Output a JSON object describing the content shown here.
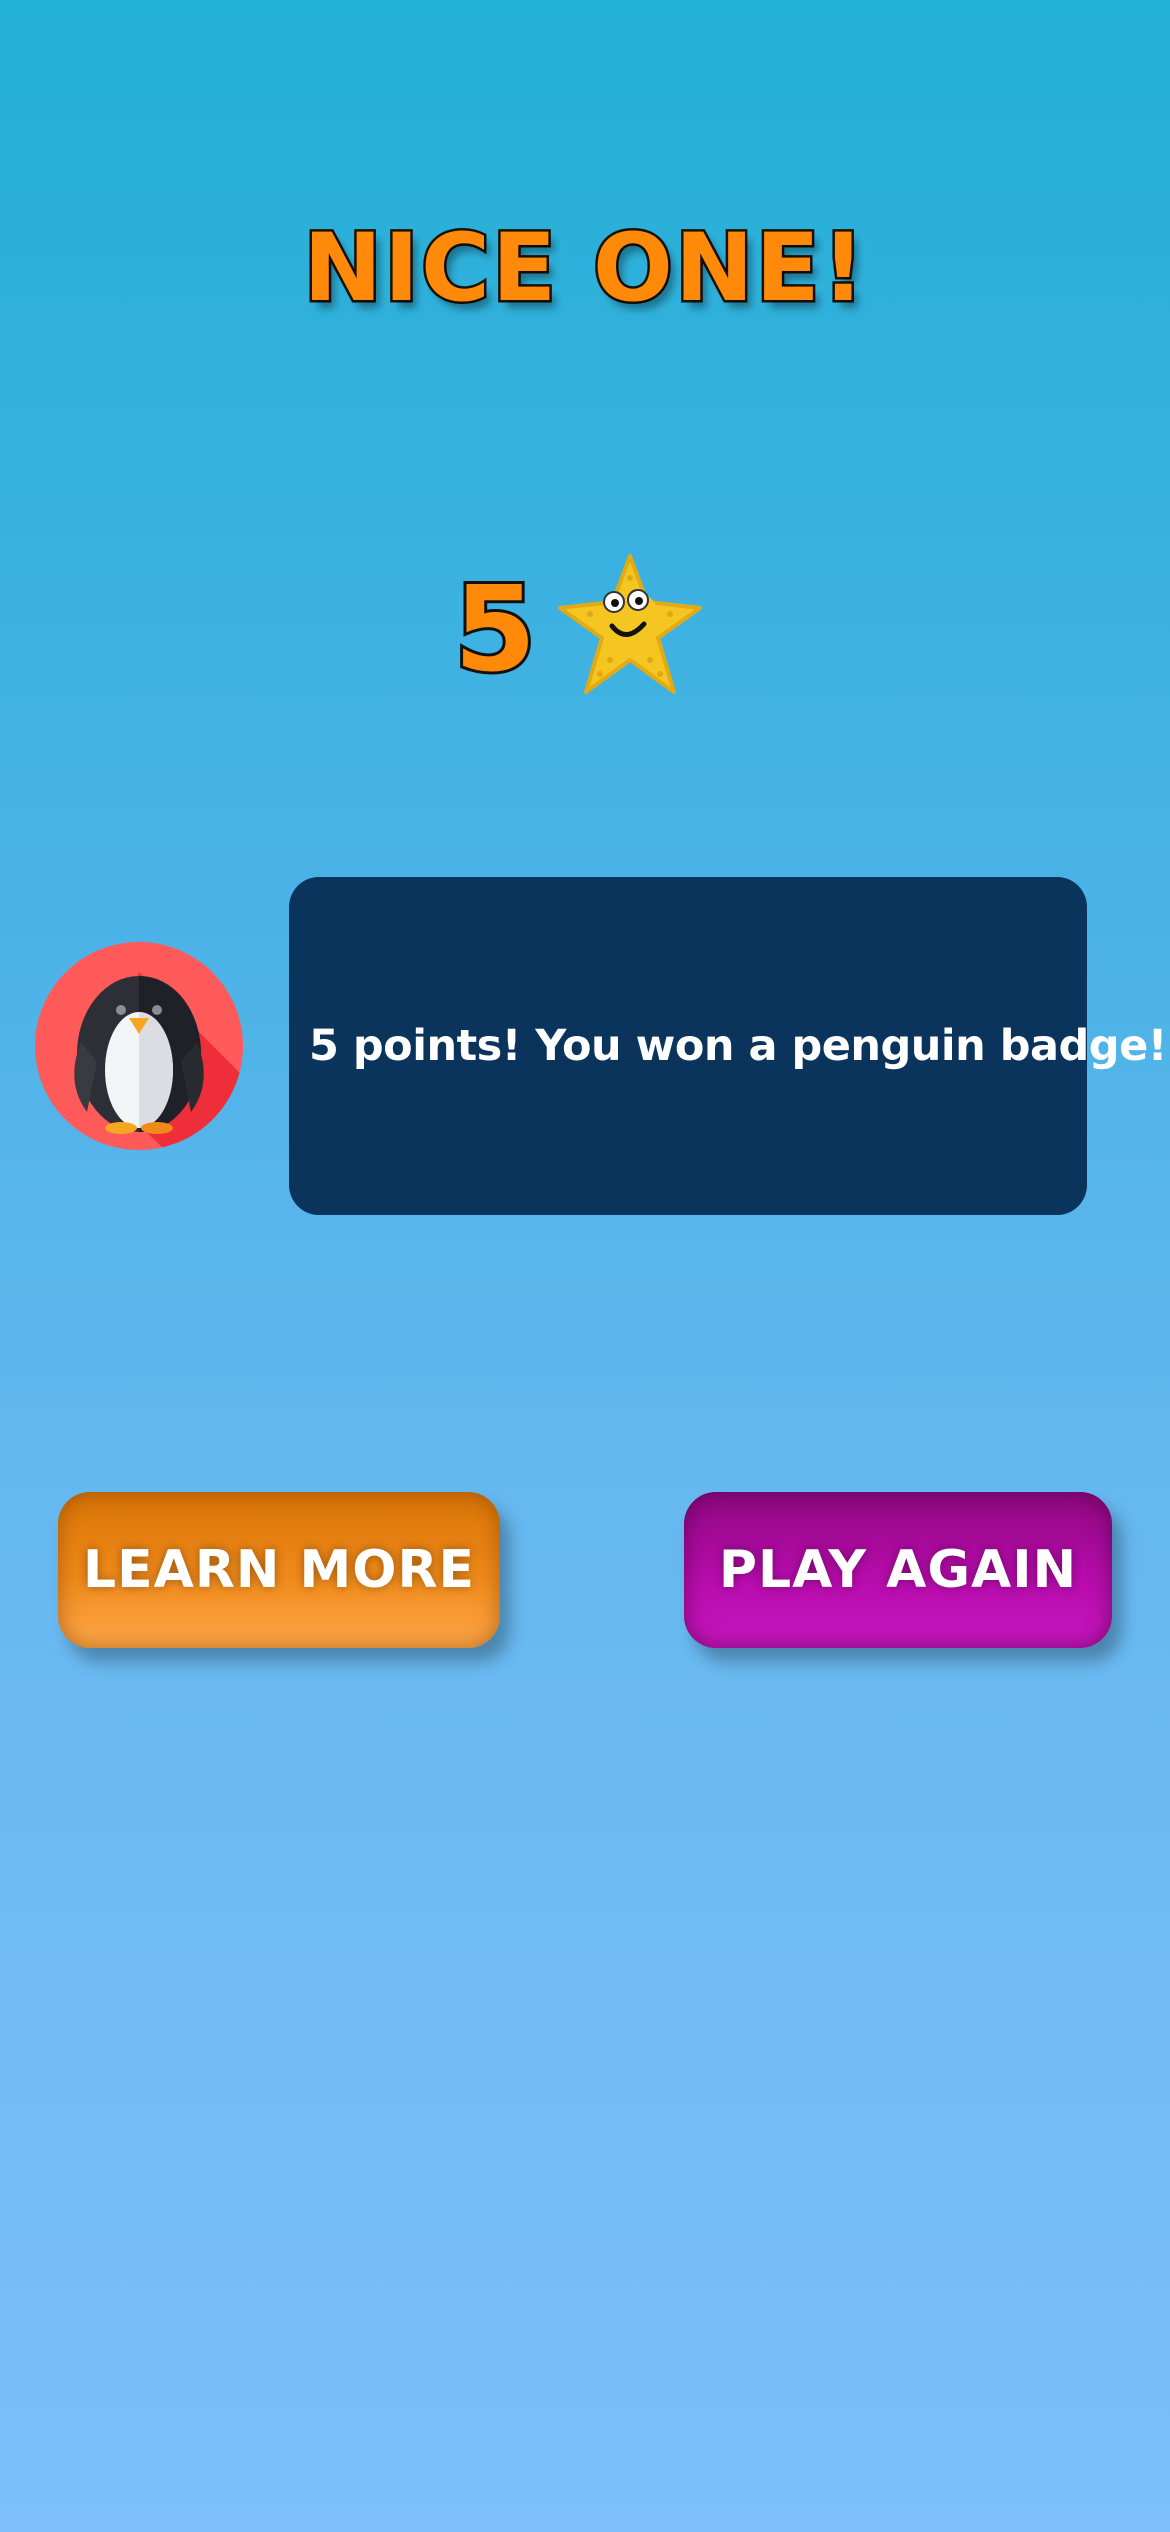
{
  "title": "NICE ONE!",
  "score": {
    "value": "5",
    "icon": "starfish-icon"
  },
  "badge": {
    "icon": "penguin-icon",
    "background_color": "#ff5a5a"
  },
  "message": {
    "text": "5 points! You won a penguin badge!"
  },
  "buttons": {
    "learn_more_label": "LEARN MORE",
    "play_again_label": "PLAY AGAIN"
  },
  "colors": {
    "title": "#ff8a0a",
    "message_box": "#0b345c",
    "learn_more": "#f08a1a",
    "play_again": "#b70cac"
  }
}
